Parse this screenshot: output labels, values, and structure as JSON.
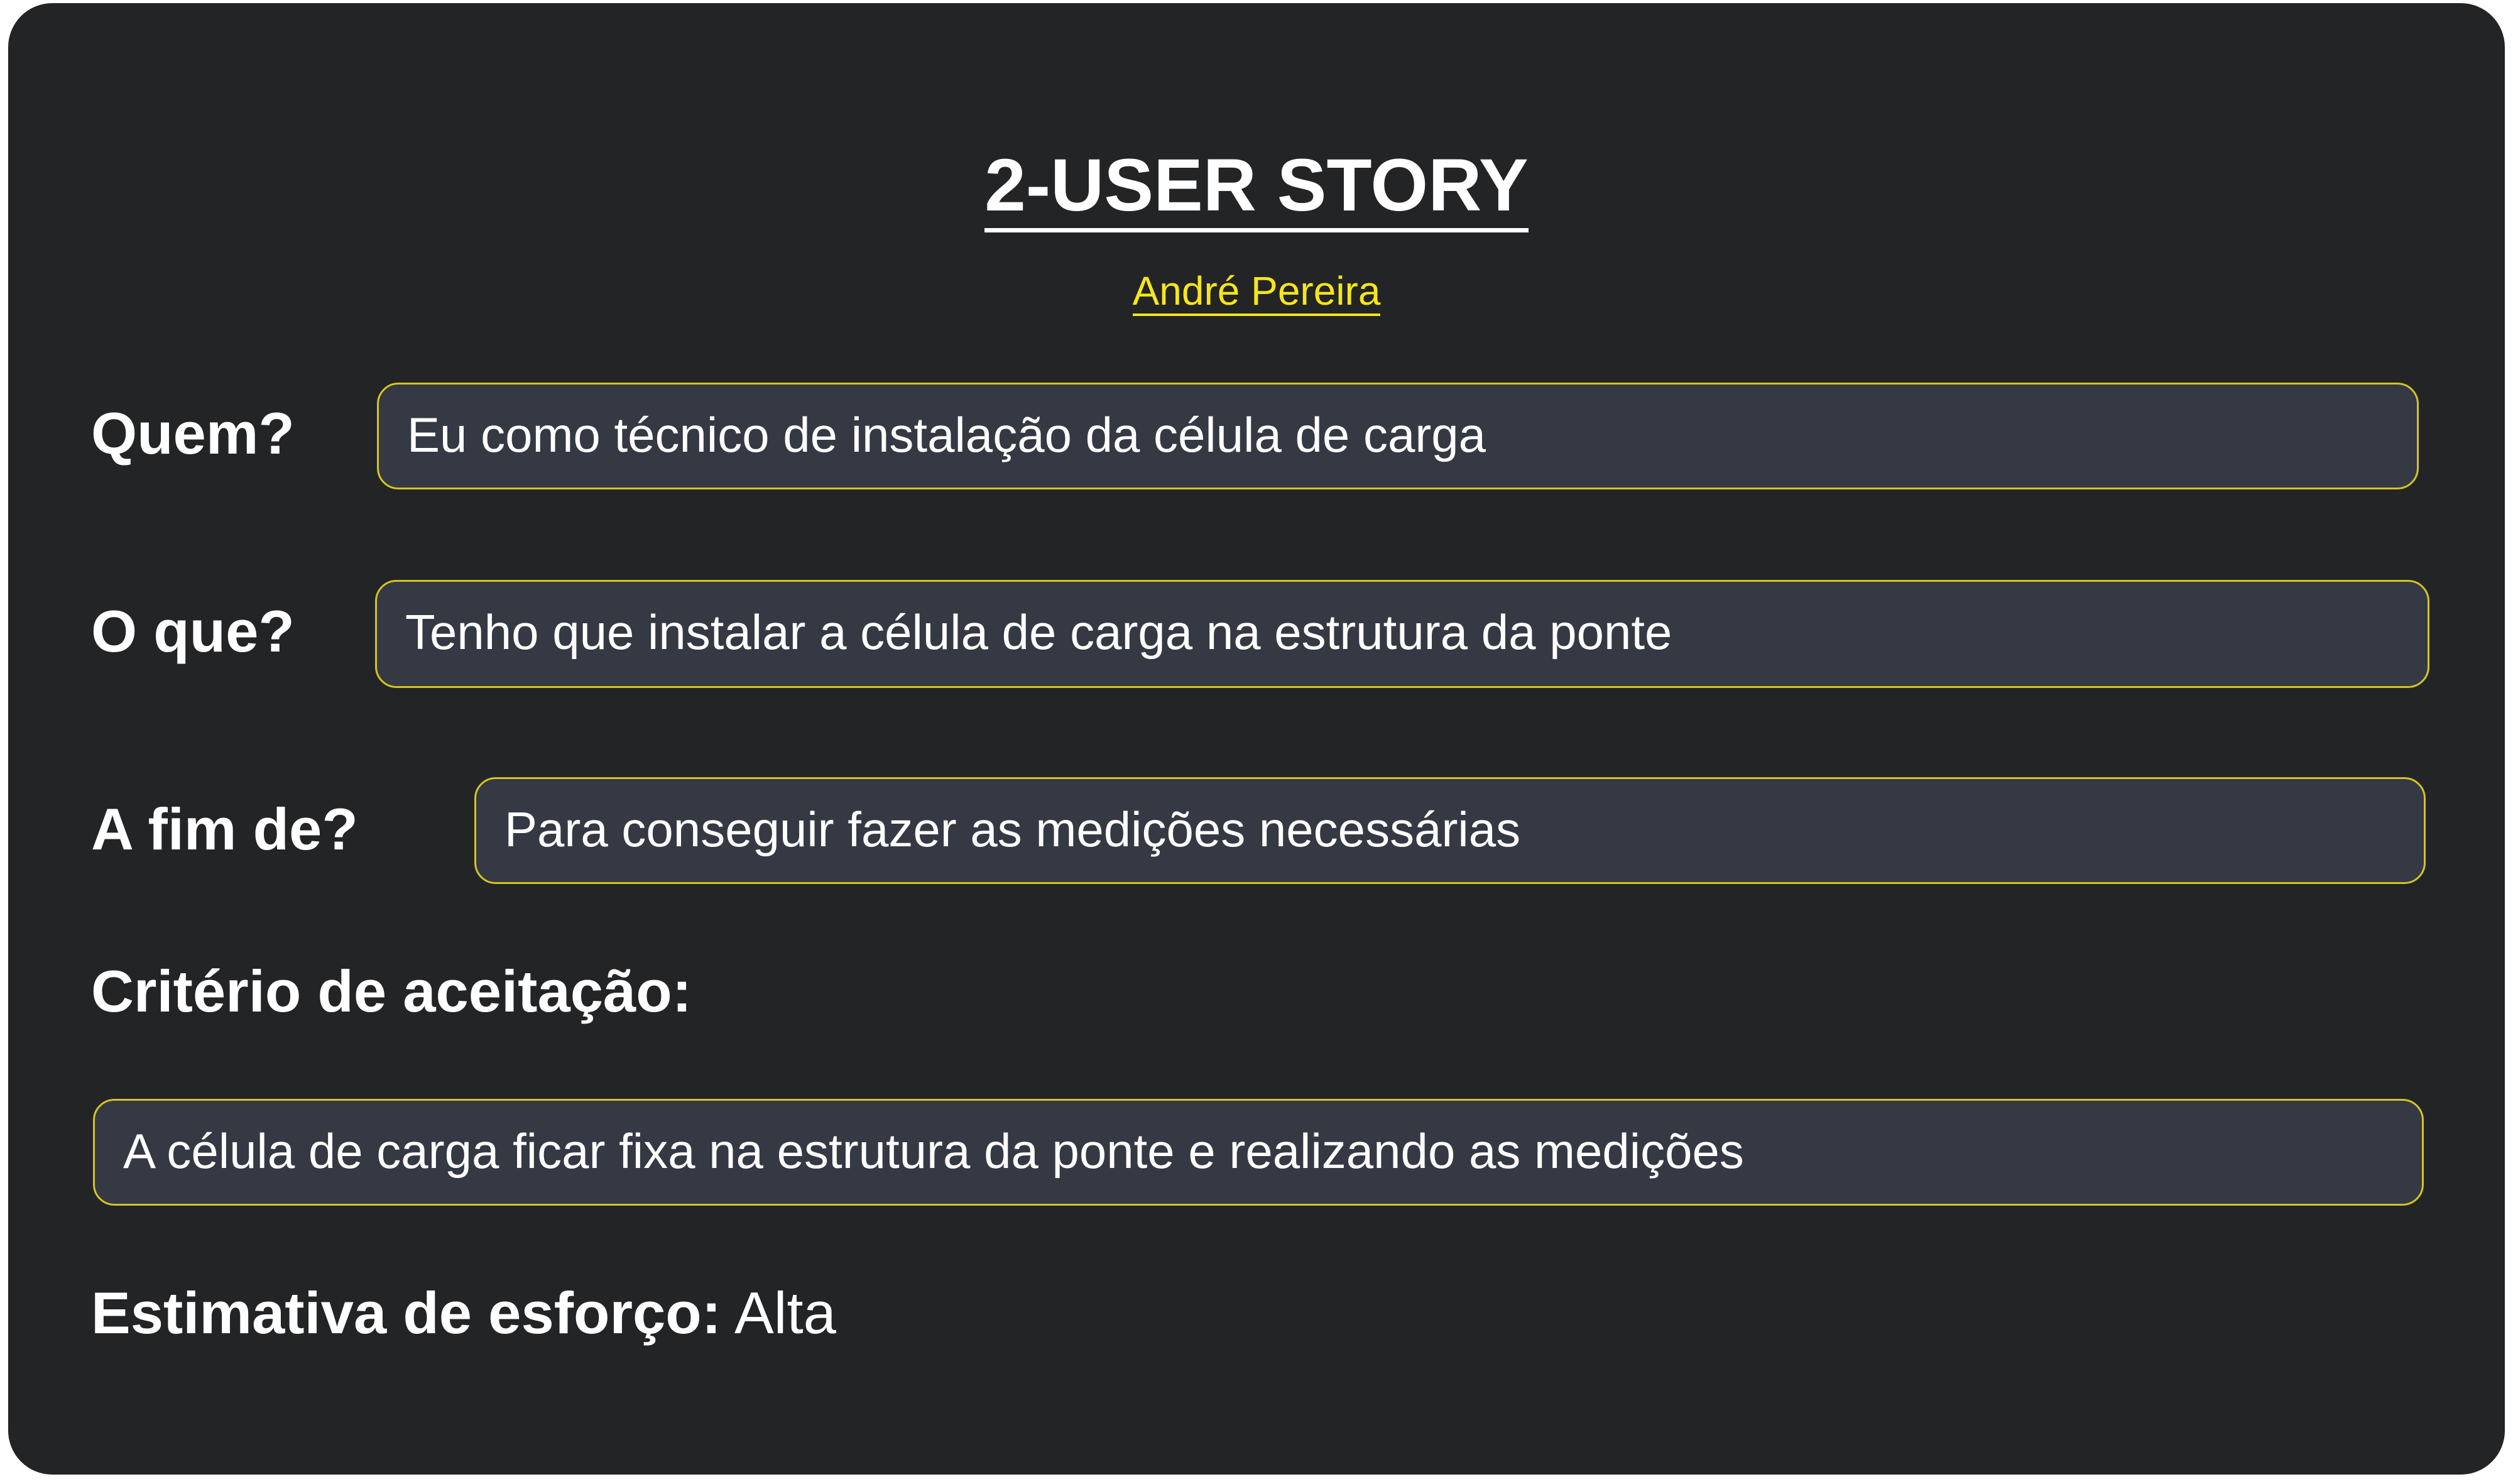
{
  "header": {
    "title": "2-USER STORY",
    "author": "André Pereira"
  },
  "fields": {
    "who": {
      "label": "Quem?",
      "value": "Eu como técnico de instalação da célula de carga"
    },
    "what": {
      "label": "O que?",
      "value": "Tenho que instalar a célula de carga na estrutura da ponte"
    },
    "why": {
      "label": "A fim de?",
      "value": "Para conseguir fazer as medições necessárias"
    }
  },
  "acceptance": {
    "label": "Critério de aceitação:",
    "value": "A célula de carga ficar fixa na estrutura da ponte e realizando as medições"
  },
  "effort": {
    "label": "Estimativa de esforço:",
    "value": "Alta"
  },
  "colors": {
    "card_background": "#232426",
    "field_background": "#353943",
    "accent_yellow": "#f5e61a"
  }
}
